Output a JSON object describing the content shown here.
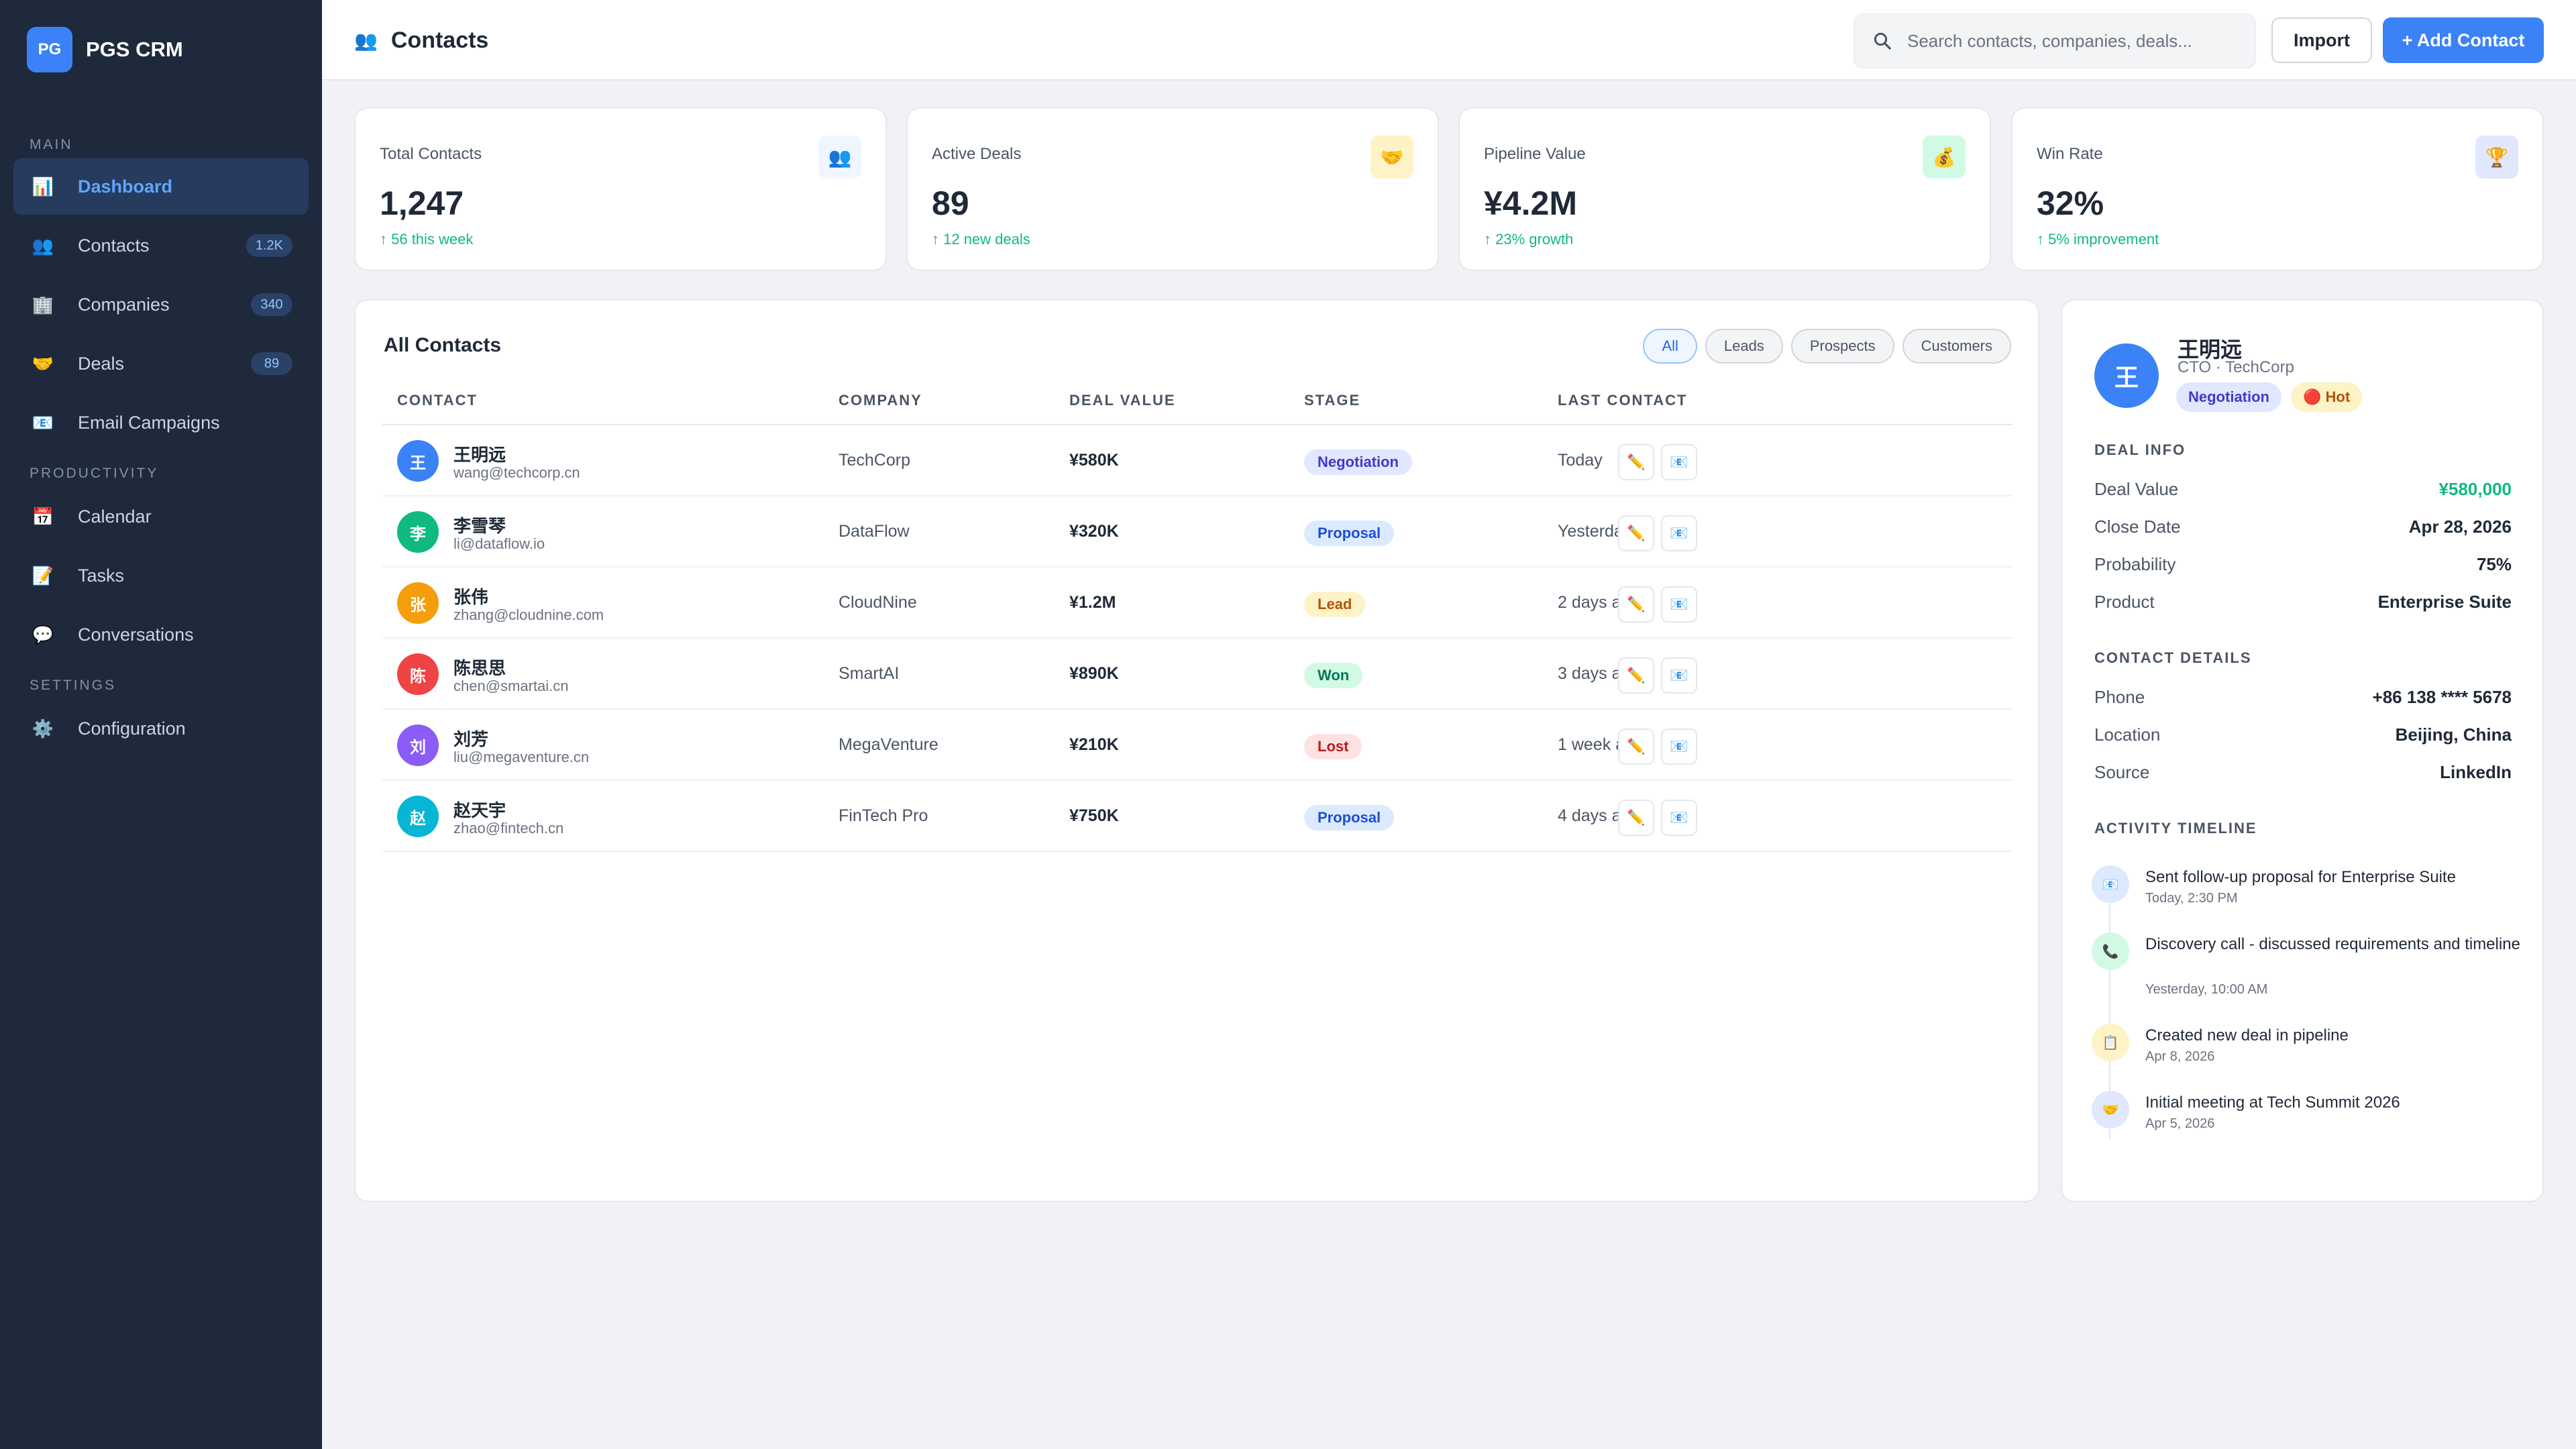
{
  "brand": {
    "logo": "PG",
    "name": "PGS CRM"
  },
  "sidebar": {
    "sections": [
      "Main",
      "Productivity",
      "Settings"
    ],
    "items": [
      {
        "label": "Dashboard",
        "icon": "📊",
        "icon_name": "bar-chart-icon",
        "active": true
      },
      {
        "label": "Contacts",
        "icon": "👥",
        "icon_name": "people-icon",
        "badge": "1.2K"
      },
      {
        "label": "Companies",
        "icon": "🏢",
        "icon_name": "building-icon",
        "badge": "340"
      },
      {
        "label": "Deals",
        "icon": "🤝",
        "icon_name": "handshake-icon",
        "badge": "89"
      },
      {
        "label": "Email Campaigns",
        "icon": "📧",
        "icon_name": "email-icon"
      },
      {
        "label": "Calendar",
        "icon": "📅",
        "icon_name": "calendar-icon"
      },
      {
        "label": "Tasks",
        "icon": "📝",
        "icon_name": "memo-icon"
      },
      {
        "label": "Conversations",
        "icon": "💬",
        "icon_name": "speech-bubble-icon"
      },
      {
        "label": "Configuration",
        "icon": "⚙️",
        "icon_name": "gear-icon"
      }
    ]
  },
  "header": {
    "title": "Contacts",
    "title_icon": "👥",
    "search_placeholder": "Search contacts, companies, deals...",
    "import_label": "Import",
    "add_label": "+ Add Contact"
  },
  "stats": [
    {
      "label": "Total Contacts",
      "value": "1,247",
      "change": "↑ 56 this week",
      "icon": "👥",
      "icon_bg": "#eff6ff"
    },
    {
      "label": "Active Deals",
      "value": "89",
      "change": "↑ 12 new deals",
      "icon": "🤝",
      "icon_bg": "#fef3c7"
    },
    {
      "label": "Pipeline Value",
      "value": "¥4.2M",
      "change": "↑ 23% growth",
      "icon": "💰",
      "icon_bg": "#d1fae5"
    },
    {
      "label": "Win Rate",
      "value": "32%",
      "change": "↑ 5% improvement",
      "icon": "🏆",
      "icon_bg": "#e0e7ff"
    }
  ],
  "table": {
    "title": "All Contacts",
    "filters": [
      "All",
      "Leads",
      "Prospects",
      "Customers"
    ],
    "active_filter": "All",
    "columns": [
      "Contact",
      "Company",
      "Deal Value",
      "Stage",
      "Last Contact"
    ],
    "rows": [
      {
        "initial": "王",
        "color": "#3b82f6",
        "name": "王明远",
        "email": "wang@techcorp.cn",
        "company": "TechCorp",
        "value": "¥580K",
        "stage": "Negotiation",
        "stage_key": "negotiation",
        "last": "Today"
      },
      {
        "initial": "李",
        "color": "#10b981",
        "name": "李雪琴",
        "email": "li@dataflow.io",
        "company": "DataFlow",
        "value": "¥320K",
        "stage": "Proposal",
        "stage_key": "proposal",
        "last": "Yesterday"
      },
      {
        "initial": "张",
        "color": "#f59e0b",
        "name": "张伟",
        "email": "zhang@cloudnine.com",
        "company": "CloudNine",
        "value": "¥1.2M",
        "stage": "Lead",
        "stage_key": "lead",
        "last": "2 days ago"
      },
      {
        "initial": "陈",
        "color": "#ef4444",
        "name": "陈思思",
        "email": "chen@smartai.cn",
        "company": "SmartAI",
        "value": "¥890K",
        "stage": "Won",
        "stage_key": "won",
        "last": "3 days ago"
      },
      {
        "initial": "刘",
        "color": "#8b5cf6",
        "name": "刘芳",
        "email": "liu@megaventure.cn",
        "company": "MegaVenture",
        "value": "¥210K",
        "stage": "Lost",
        "stage_key": "lost",
        "last": "1 week ago"
      },
      {
        "initial": "赵",
        "color": "#06b6d4",
        "name": "赵天宇",
        "email": "zhao@fintech.cn",
        "company": "FinTech Pro",
        "value": "¥750K",
        "stage": "Proposal",
        "stage_key": "proposal",
        "last": "4 days ago"
      }
    ],
    "edit_icon": "✏️",
    "email_icon": "📧"
  },
  "detail": {
    "initial": "王",
    "name": "王明远",
    "title": "CTO · TechCorp",
    "tags": [
      "Negotiation",
      "🔴 Hot"
    ],
    "deal_info_heading": "Deal Info",
    "deal_info": [
      {
        "k": "Deal Value",
        "v": "¥580,000",
        "accent": true
      },
      {
        "k": "Close Date",
        "v": "Apr 28, 2026"
      },
      {
        "k": "Probability",
        "v": "75%"
      },
      {
        "k": "Product",
        "v": "Enterprise Suite"
      }
    ],
    "contact_heading": "Contact Details",
    "contact": [
      {
        "k": "Phone",
        "v": "+86 138 **** 5678"
      },
      {
        "k": "Location",
        "v": "Beijing, China"
      },
      {
        "k": "Source",
        "v": "LinkedIn"
      }
    ],
    "timeline_heading": "Activity Timeline",
    "timeline": [
      {
        "icon": "📧",
        "icon_name": "email-icon",
        "bg": "#dbeafe",
        "text": "Sent follow-up proposal for Enterprise Suite",
        "time": "Today, 2:30 PM"
      },
      {
        "icon": "📞",
        "icon_name": "phone-icon",
        "bg": "#d1fae5",
        "text": "Discovery call - discussed requirements and timeline",
        "time": "Yesterday, 10:00 AM"
      },
      {
        "icon": "📋",
        "icon_name": "clipboard-icon",
        "bg": "#fef3c7",
        "text": "Created new deal in pipeline",
        "time": "Apr 8, 2026"
      },
      {
        "icon": "🤝",
        "icon_name": "handshake-icon",
        "bg": "#e0e7ff",
        "text": "Initial meeting at Tech Summit 2026",
        "time": "Apr 5, 2026"
      }
    ]
  }
}
